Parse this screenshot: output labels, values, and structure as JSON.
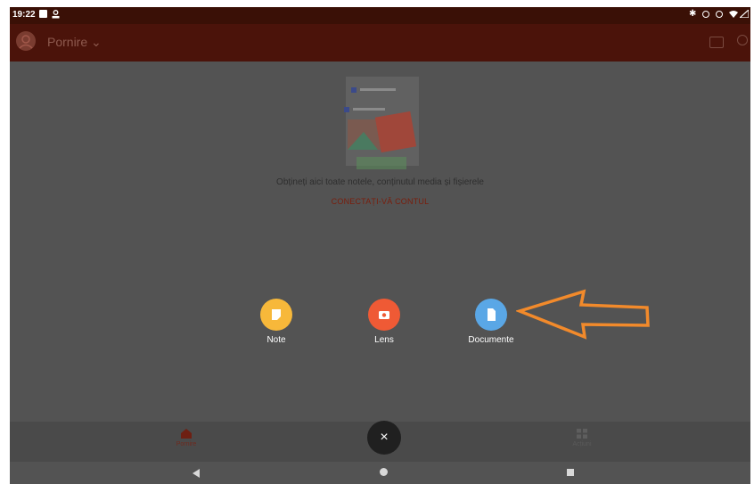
{
  "status_bar": {
    "time": "19:22"
  },
  "app_bar": {
    "title": "Pornire ⌄"
  },
  "empty_state": {
    "message": "Obțineți aici toate notele, conținutul media și fișierele",
    "connect_link": "CONECTAȚI-VĂ CONTUL"
  },
  "fab_menu": {
    "options": [
      {
        "label": "Note",
        "color": "#f7b83a",
        "icon": "note-icon"
      },
      {
        "label": "Lens",
        "color": "#ef5a35",
        "icon": "camera-icon"
      },
      {
        "label": "Documente",
        "color": "#5aa7e6",
        "icon": "document-icon"
      }
    ],
    "close_icon": "×"
  },
  "bottom_nav": {
    "items": [
      {
        "label": "Pornire",
        "icon": "home-icon"
      },
      {
        "label": "Acțiuni",
        "icon": "grid-icon"
      }
    ]
  },
  "annotation": {
    "color": "#f28a2b"
  }
}
